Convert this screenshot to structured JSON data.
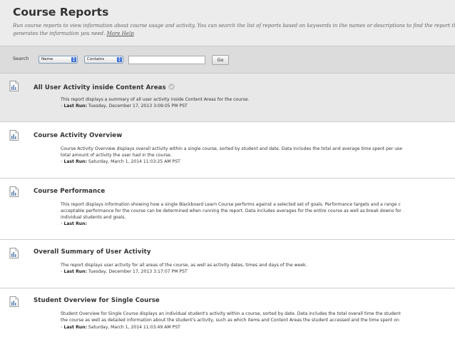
{
  "header": {
    "title": "Course Reports",
    "description_lines": [
      "Run course reports to view information about course usage and activity. You can search the list of reports based on keywords in the names or descriptions to find the report th",
      "generates the information you need."
    ],
    "more_help": "More Help"
  },
  "search": {
    "label": "Search",
    "field_select": "Name",
    "operator_select": "Contains",
    "input_value": "",
    "go_label": "Go"
  },
  "reports": [
    {
      "title": "All User Activity inside Content Areas",
      "description_lines": [
        "This report displays a summary of all user activity inside Content Areas for the course."
      ],
      "last_run_label": "Last Run:",
      "last_run_value": "Tuesday, December 17, 2013 3:09:05 PM PST"
    },
    {
      "title": "Course Activity Overview",
      "description_lines": [
        "Course Activity Overview displays overall activity within a single course, sorted by student and date. Data includes the total and average time spent per use",
        "total amount of activity the user had in the course."
      ],
      "last_run_label": "Last Run:",
      "last_run_value": "Saturday, March 1, 2014 11:03:25 AM PST"
    },
    {
      "title": "Course Performance",
      "description_lines": [
        "This report displays information showing how a single Blackboard Learn Course performs against a selected set of goals. Performance targets and a range c",
        "acceptable performance for the course can be determined when running the report. Data includes averages for the entire course as well as break downs for",
        "individual students and goals."
      ],
      "last_run_label": "Last Run:",
      "last_run_value": ""
    },
    {
      "title": "Overall Summary of User Activity",
      "description_lines": [
        "The report displays user activity for all areas of the course, as well as activity dates, times and days of the week."
      ],
      "last_run_label": "Last Run:",
      "last_run_value": "Tuesday, December 17, 2013 3:17:07 PM PST"
    },
    {
      "title": "Student Overview for Single Course",
      "description_lines": [
        "Student Overview for Single Course displays an individual student's activity within a course, sorted by date. Data includes the total overall time the student",
        "the course as well as detailed information about the student's activity, such as which items and Content Areas the student accessed and the time spent on"
      ],
      "last_run_label": "Last Run:",
      "last_run_value": "Saturday, March 1, 2014 11:03:49 AM PST"
    }
  ]
}
